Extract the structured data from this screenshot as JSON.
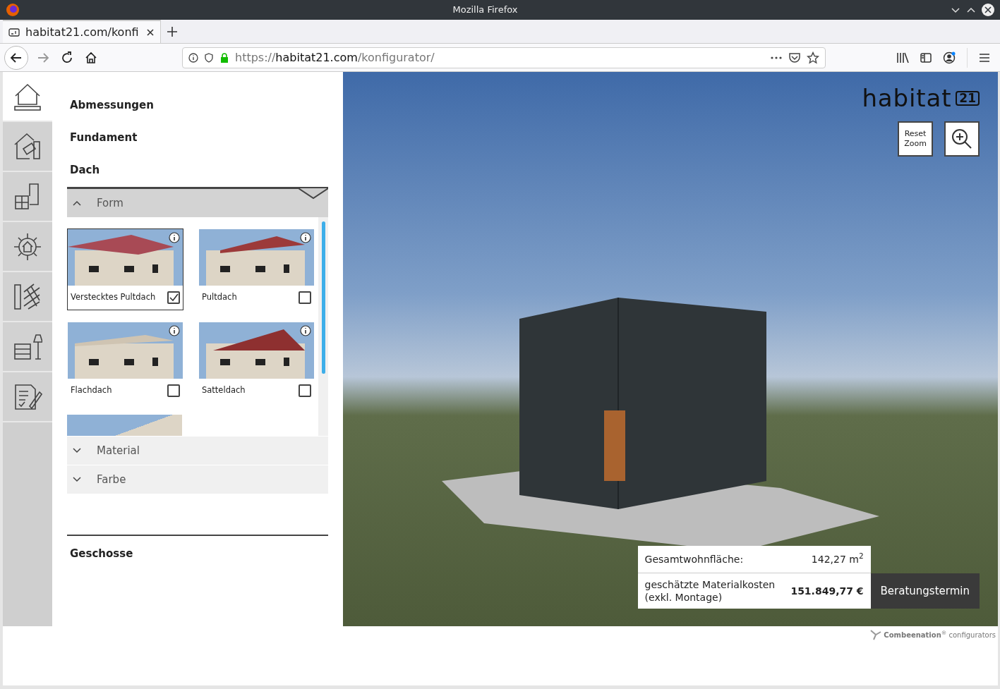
{
  "window": {
    "title": "Mozilla Firefox"
  },
  "tabs": [
    {
      "label": "habitat21.com/konfi",
      "selected": true
    }
  ],
  "address_bar": {
    "scheme": "https://",
    "host": "habitat21.com",
    "path": "/konfigurator/"
  },
  "side_nav": [
    {
      "selected": true
    },
    {
      "selected": false
    },
    {
      "selected": false
    },
    {
      "selected": false
    },
    {
      "selected": false
    },
    {
      "selected": false
    },
    {
      "selected": false
    }
  ],
  "sections_top": [
    "Abmessungen",
    "Fundament",
    "Dach"
  ],
  "accordion": [
    {
      "label": "Form",
      "expanded": true
    },
    {
      "label": "Material",
      "expanded": false
    },
    {
      "label": "Farbe",
      "expanded": false
    }
  ],
  "roof_options": [
    {
      "label": "Verstecktes Pultdach",
      "checked": true
    },
    {
      "label": "Pultdach",
      "checked": false
    },
    {
      "label": "Flachdach",
      "checked": false
    },
    {
      "label": "Satteldach",
      "checked": false
    }
  ],
  "sections_bottom": [
    "Geschosse"
  ],
  "viewer": {
    "logo_word": "habitat",
    "logo_badge": "21",
    "reset_zoom": "Reset Zoom"
  },
  "summary": {
    "area_label": "Gesamtwohnfläche:",
    "area_value": "142,27 m$^{2}$",
    "cost_label": "geschätzte Materialkosten (exkl. Montage)",
    "cost_value": "151.849,77 €",
    "cta": "Beratungstermin"
  },
  "footer": {
    "brand": "Combeenation",
    "mark": "®",
    "suffix": "configurators"
  }
}
